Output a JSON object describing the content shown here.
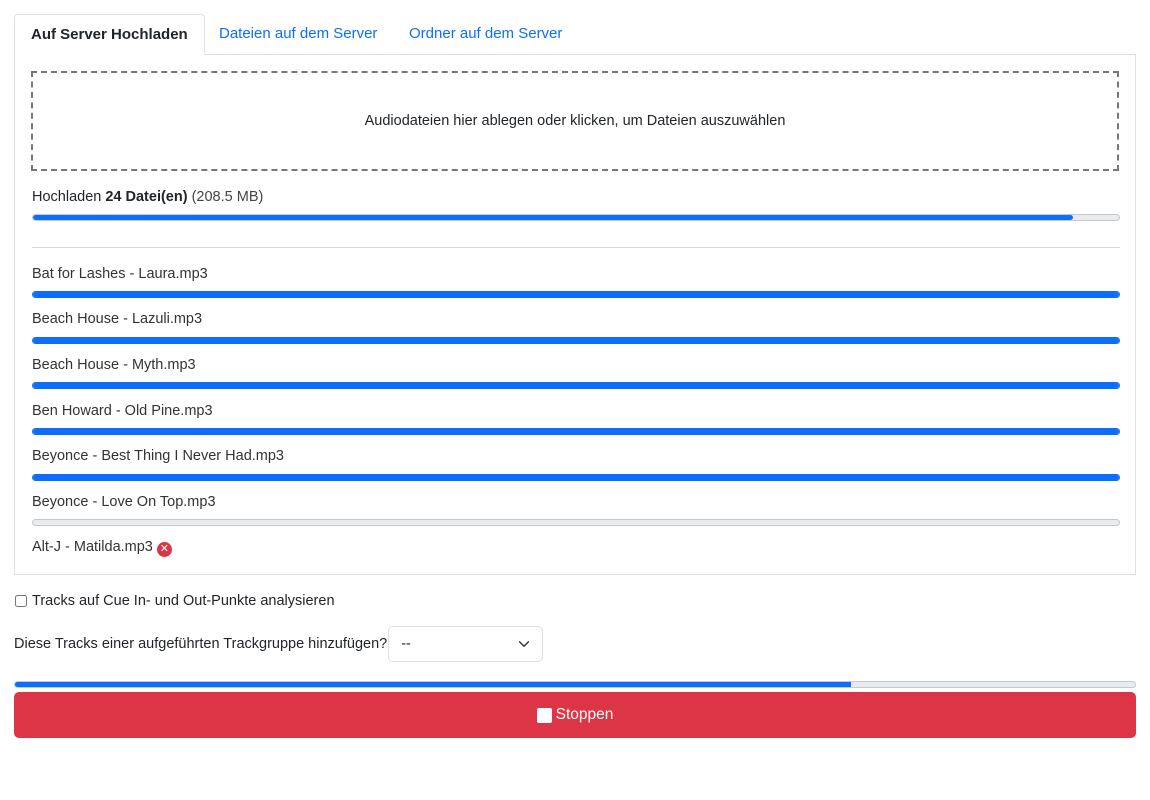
{
  "tabs": [
    {
      "label": "Auf Server Hochladen",
      "active": true
    },
    {
      "label": "Dateien auf dem Server",
      "active": false
    },
    {
      "label": "Ordner auf dem Server",
      "active": false
    }
  ],
  "dropzone": {
    "text": "Audiodateien hier ablegen oder klicken, um Dateien auszuwählen"
  },
  "upload_summary": {
    "prefix": "Hochladen",
    "count": "24 Datei(en)",
    "size": "(208.5 MB)",
    "progress": 0.958
  },
  "files": [
    {
      "name": "Bat for Lashes - Laura.mp3",
      "progress": 1.0,
      "status": "done"
    },
    {
      "name": "Beach House - Lazuli.mp3",
      "progress": 1.0,
      "status": "done"
    },
    {
      "name": "Beach House - Myth.mp3",
      "progress": 1.0,
      "status": "done"
    },
    {
      "name": "Ben Howard - Old Pine.mp3",
      "progress": 1.0,
      "status": "done"
    },
    {
      "name": "Beyonce - Best Thing I Never Had.mp3",
      "progress": 1.0,
      "status": "done"
    },
    {
      "name": "Beyonce - Love On Top.mp3",
      "progress": 0.0,
      "status": "pending"
    },
    {
      "name": "Alt-J - Matilda.mp3",
      "progress": null,
      "status": "error"
    }
  ],
  "options": {
    "analyze_label": "Tracks auf Cue In- und Out-Punkte analysieren",
    "analyze_checked": false,
    "group_label": "Diese Tracks einer aufgeführten Trackgruppe hinzufügen?",
    "group_selected": "--"
  },
  "overall_progress": 0.746,
  "stop_button": {
    "label": "Stoppen"
  },
  "colors": {
    "accent": "#0d6efd",
    "danger": "#dc3545"
  }
}
